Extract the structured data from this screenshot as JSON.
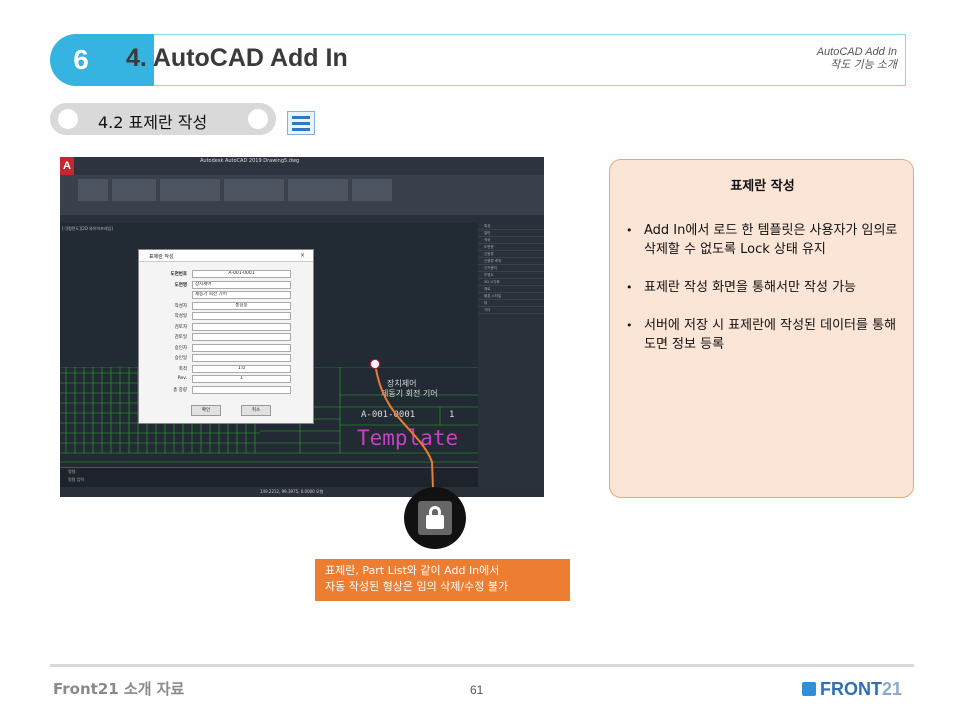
{
  "header": {
    "number": "6",
    "title": "4. AutoCAD Add In",
    "subtitle_line1": "AutoCAD Add In",
    "subtitle_line2": "작도 기능 소개"
  },
  "section": {
    "label": "4.2 표제란 작성"
  },
  "cad": {
    "window_title": "Autodesk AutoCAD 2019   Drawing5.dwg",
    "menu": [
      "파일(F)",
      "편집(E)",
      "뷰(V)",
      "삽입(I)",
      "형식(O)",
      "도구(T)",
      "그리기(D)",
      "치수(N)",
      "수정(M)",
      "파라메트릭(P)",
      "윈도우(W)",
      "도움말(H)",
      "Front21애드인"
    ],
    "tabs": [
      "시작",
      "Drawing1",
      "Drawing3*",
      "Drawing4*"
    ],
    "viewport_label": "[-][평면도][2D 와이어프레임]",
    "properties": [
      "특성",
      "일반",
      "색상",
      "도면층",
      "선종류",
      "선종류 축척",
      "선가중치",
      "투명도",
      "3D 시각화",
      "재료",
      "플롯 스타일",
      "뷰",
      "기타"
    ],
    "command_label": "명령:",
    "command_placeholder": "명령 입력",
    "coords": "149.2212, 99.3975, 0.0000  모형",
    "title_block_name1": "장치제어",
    "title_block_name2": "제동기 회전 기어",
    "title_block_number": "A-001-0001",
    "title_block_sheet": "1",
    "template_text": "Template"
  },
  "dialog": {
    "title": "표제란 작성",
    "fields": [
      {
        "label": "도면번호",
        "value": "A-001-0001",
        "bold": true,
        "center": true
      },
      {
        "label": "도면명",
        "value": "장치제어",
        "bold": true,
        "center": false
      },
      {
        "label": "",
        "value": "제동기 회전 기어",
        "bold": false,
        "center": false
      },
      {
        "label": "작성자",
        "value": "홍길동",
        "bold": false,
        "center": true
      },
      {
        "label": "작성일",
        "value": "",
        "bold": false,
        "center": false
      },
      {
        "label": "검토자",
        "value": "",
        "bold": false,
        "center": false
      },
      {
        "label": "검토일",
        "value": "",
        "bold": false,
        "center": false
      },
      {
        "label": "승인자",
        "value": "",
        "bold": false,
        "center": false
      },
      {
        "label": "승인일",
        "value": "",
        "bold": false,
        "center": false
      },
      {
        "label": "축척",
        "value": "1:0",
        "bold": false,
        "center": true
      },
      {
        "label": "Rev.",
        "value": "1",
        "bold": false,
        "center": true
      },
      {
        "label": "총 중량",
        "value": "",
        "bold": false,
        "center": false
      }
    ],
    "ok_label": "확인",
    "cancel_label": "취소"
  },
  "callout": {
    "line1": "표제란, Part List와 같이 Add In에서",
    "line2": "자동 작성된 형상은 임의 삭제/수정 불가"
  },
  "panel": {
    "title": "표제란 작성",
    "bullets": [
      "Add In에서 로드 한 템플릿은 사용자가 임의로 삭제할 수 없도록 Lock 상태 유지",
      "표제란 작성 화면을 통해서만 작성 가능",
      "서버에 저장 시 표제란에 작성된 데이터를 통해 도면 정보 등록"
    ]
  },
  "footer": {
    "left": "Front21 소개 자료",
    "page": "61",
    "logo": "FRONT",
    "logo_num": "21"
  },
  "colors": {
    "accent_blue": "#35b3e1",
    "orange": "#ed7d31",
    "panel_bg": "#fbe5d6",
    "template_magenta": "#c740c7"
  }
}
